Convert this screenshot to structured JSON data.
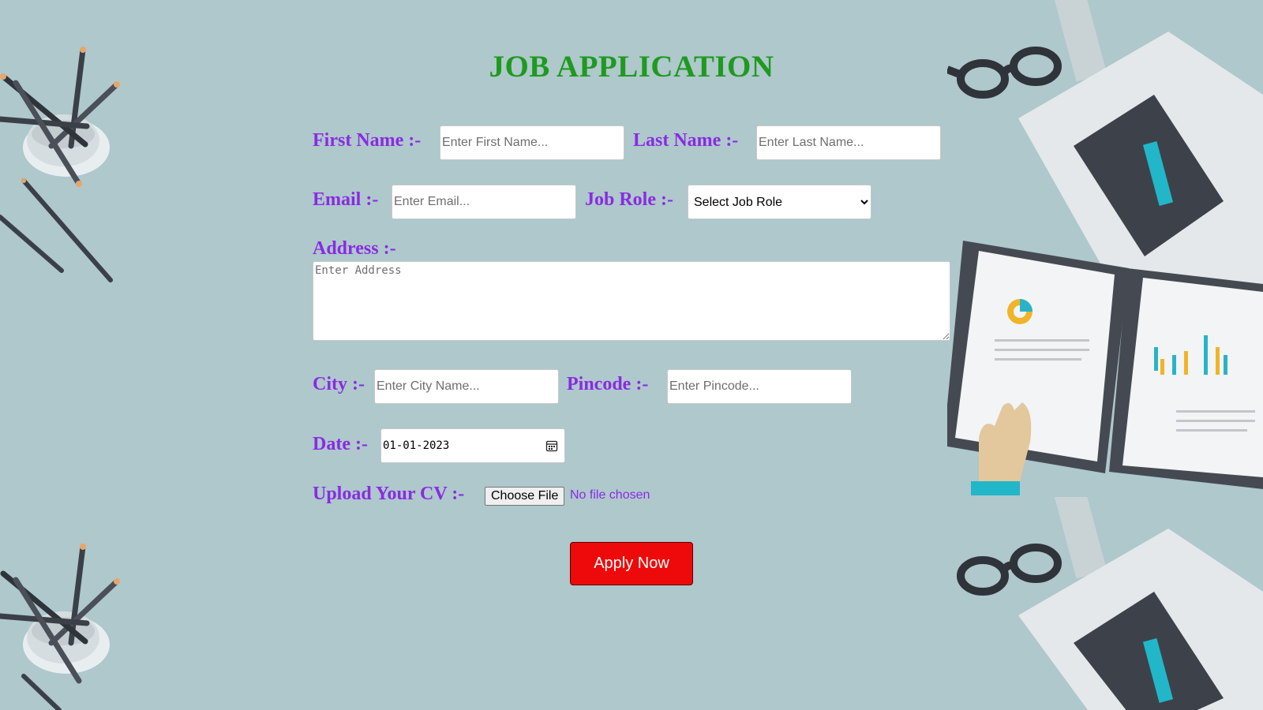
{
  "title": "JOB APPLICATION",
  "form": {
    "first_name": {
      "label": "First Name :-",
      "placeholder": "Enter First Name..."
    },
    "last_name": {
      "label": "Last Name :-",
      "placeholder": "Enter Last Name..."
    },
    "email": {
      "label": "Email :-",
      "placeholder": "Enter Email..."
    },
    "job_role": {
      "label": "Job Role :-",
      "selected": "Select Job Role"
    },
    "address": {
      "label": "Address :-",
      "placeholder": "Enter Address"
    },
    "city": {
      "label": "City :-",
      "placeholder": "Enter City Name..."
    },
    "pincode": {
      "label": "Pincode :-",
      "placeholder": "Enter Pincode..."
    },
    "date": {
      "label": "Date :-",
      "value": "01-01-2023"
    },
    "cv": {
      "label": "Upload Your CV :-",
      "button": "Choose File",
      "status": "No file chosen"
    },
    "submit_label": "Apply Now"
  },
  "colors": {
    "background": "#aec8cc",
    "title": "#1f9a1f",
    "labels": "#8a2be2",
    "submit": "#ee0a0a"
  },
  "icons": [
    "calendar-icon",
    "chevron-down-icon"
  ]
}
